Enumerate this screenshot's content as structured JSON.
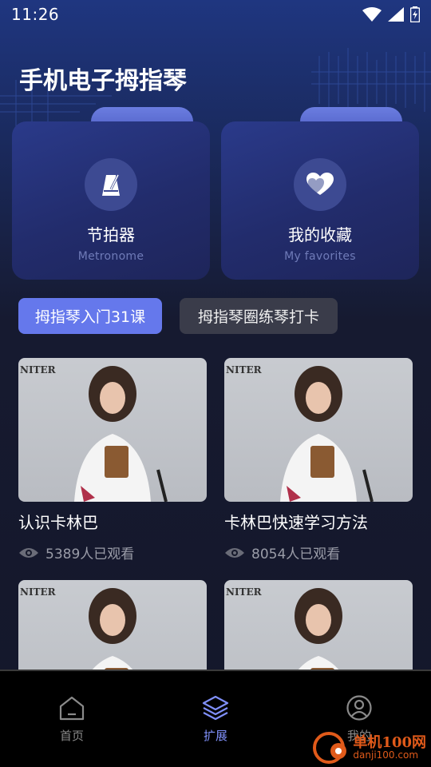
{
  "status_bar": {
    "time": "11:26"
  },
  "header": {
    "title": "手机电子拇指琴"
  },
  "feature_cards": [
    {
      "title": "节拍器",
      "subtitle": "Metronome",
      "icon": "metronome-icon"
    },
    {
      "title": "我的收藏",
      "subtitle": "My favorites",
      "icon": "heart-icon"
    }
  ],
  "tabs": [
    {
      "label": "拇指琴入门31课",
      "active": true
    },
    {
      "label": "拇指琴圈练琴打卡",
      "active": false
    }
  ],
  "videos": [
    {
      "title": "认识卡林巴",
      "views": "5389人已观看",
      "watermark": "NITER"
    },
    {
      "title": "卡林巴快速学习方法",
      "views": "8054人已观看",
      "watermark": "NITER"
    },
    {
      "title": "",
      "views": "",
      "watermark": "NITER"
    },
    {
      "title": "",
      "views": "",
      "watermark": "NITER"
    }
  ],
  "bottom_nav": [
    {
      "label": "首页",
      "icon": "home-icon",
      "active": false
    },
    {
      "label": "扩展",
      "icon": "layers-icon",
      "active": true
    },
    {
      "label": "我的",
      "icon": "profile-icon",
      "active": false
    }
  ],
  "site_watermark": {
    "name": "单机100网",
    "url": "danji100.com"
  },
  "colors": {
    "accent": "#6578ec",
    "nav_active": "#7f8ff8",
    "background": "#14172a"
  }
}
